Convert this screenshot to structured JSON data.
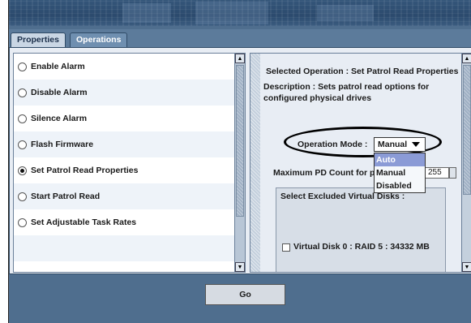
{
  "tabs": [
    {
      "label": "Properties",
      "active": false
    },
    {
      "label": "Operations",
      "active": true
    }
  ],
  "operations_list": {
    "items": [
      {
        "label": "Enable Alarm",
        "selected": false
      },
      {
        "label": "Disable Alarm",
        "selected": false
      },
      {
        "label": "Silence Alarm",
        "selected": false
      },
      {
        "label": "Flash Firmware",
        "selected": false
      },
      {
        "label": "Set Patrol Read Properties",
        "selected": true
      },
      {
        "label": "Start Patrol Read",
        "selected": false
      },
      {
        "label": "Set Adjustable Task Rates",
        "selected": false
      }
    ]
  },
  "details": {
    "selected_operation": "Selected Operation : Set Patrol Read Properties",
    "description_line1": "Description : Sets patrol read options for",
    "description_line2": "configured physical drives",
    "operation_mode_label": "Operation Mode :",
    "operation_mode_value": "Manual",
    "operation_mode_options": [
      "Auto",
      "Manual",
      "Disabled"
    ],
    "operation_mode_highlighted": "Auto",
    "max_pd_label": "Maximum PD Count for p",
    "max_pd_value": "255",
    "excluded_label": "Select Excluded Virtual Disks :",
    "virtual_disks": [
      {
        "label": "Virtual Disk 0 : RAID 5 : 34332 MB",
        "checked": false
      }
    ]
  },
  "go_button": "Go",
  "colors": {
    "banner": "#2b4a6d",
    "frame": "#4f6e8e",
    "highlight": "#8b9bd6"
  }
}
